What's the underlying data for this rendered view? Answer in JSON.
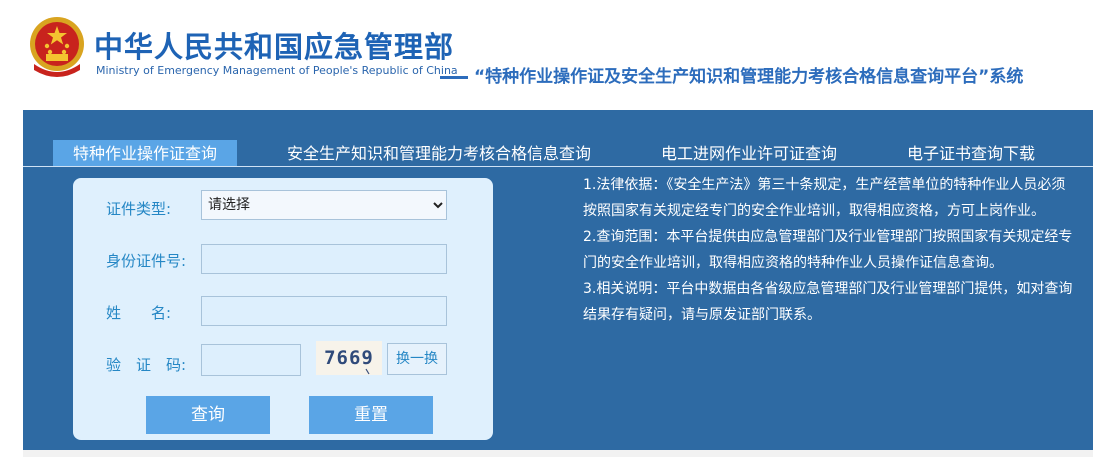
{
  "header": {
    "org_name_cn": "中华人民共和国应急管理部",
    "org_name_en": "Ministry of Emergency Management of People's Republic of China",
    "system_title": "“特种作业操作证及安全生产知识和管理能力考核合格信息查询平台”系统"
  },
  "tabs": [
    {
      "label": "特种作业操作证查询",
      "active": true
    },
    {
      "label": "安全生产知识和管理能力考核合格信息查询",
      "active": false
    },
    {
      "label": "电工进网作业许可证查询",
      "active": false
    },
    {
      "label": "电子证书查询下载",
      "active": false
    }
  ],
  "form": {
    "cert_type_label": "证件类型:",
    "cert_type_value": "请选择",
    "id_label": "身份证件号:",
    "id_value": "",
    "name_label": "姓　　名:",
    "name_value": "",
    "captcha_label": "验　证　码:",
    "captcha_value": "",
    "captcha_text": "7669",
    "swap_label": "换一换",
    "query_button": "查询",
    "reset_button": "重置"
  },
  "notes": [
    "1.法律依据：《安全生产法》第三十条规定，生产经营单位的特种作业人员必须按照国家有关规定经专门的安全作业培训，取得相应资格，方可上岗作业。",
    "2.查询范围：本平台提供由应急管理部门及行业管理部门按照国家有关规定经专门的安全作业培训，取得相应资格的特种作业人员操作证信息查询。",
    "3.相关说明：平台中数据由各省级应急管理部门及行业管理部门提供，如对查询结果存有疑问，请与原发证部门联系。"
  ],
  "colors": {
    "panel": "#2e6aa3",
    "accent": "#5aa5e6",
    "form_bg": "#dff0fd",
    "brand_blue": "#1e63b5"
  }
}
